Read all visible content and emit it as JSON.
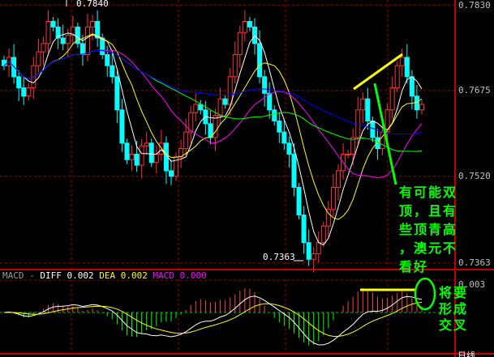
{
  "chart_data": {
    "type": "candlestick",
    "price_axis": {
      "ticks": [
        0.783,
        0.7675,
        0.752,
        0.7363
      ],
      "ylim": [
        0.7363,
        0.783
      ]
    },
    "max_label": "0.7840",
    "min_label": "0.7363",
    "closes": [
      0.772,
      0.7735,
      0.77,
      0.768,
      0.7665,
      0.768,
      0.772,
      0.7745,
      0.776,
      0.78,
      0.779,
      0.777,
      0.776,
      0.7775,
      0.779,
      0.776,
      0.774,
      0.779,
      0.78,
      0.777,
      0.774,
      0.772,
      0.77,
      0.764,
      0.758,
      0.755,
      0.756,
      0.754,
      0.7575,
      0.758,
      0.7545,
      0.756,
      0.758,
      0.753,
      0.752,
      0.7555,
      0.757,
      0.76,
      0.7635,
      0.765,
      0.764,
      0.7615,
      0.759,
      0.763,
      0.766,
      0.765,
      0.77,
      0.774,
      0.778,
      0.78,
      0.779,
      0.776,
      0.77,
      0.767,
      0.764,
      0.762,
      0.76,
      0.758,
      0.756,
      0.75,
      0.745,
      0.74,
      0.737,
      0.738,
      0.74,
      0.743,
      0.746,
      0.75,
      0.753,
      0.756,
      0.756,
      0.759,
      0.764,
      0.766,
      0.762,
      0.759,
      0.757,
      0.76,
      0.764,
      0.768,
      0.772,
      0.7735,
      0.77,
      0.7665,
      0.764,
      0.765
    ],
    "moving_averages": [
      {
        "period": 5,
        "color": "#ffffff"
      },
      {
        "period": 10,
        "color": "#ffff00"
      },
      {
        "period": 20,
        "color": "#ff00ff"
      },
      {
        "period": 30,
        "color": "#00ff00"
      },
      {
        "period": 60,
        "color": "#0000ff"
      }
    ],
    "macd": {
      "name": "MACD",
      "diff_label": "DIFF",
      "diff": "0.002",
      "dea_label": "DEA",
      "dea": "0.002",
      "macd_label": "MACD",
      "macd": "0.000",
      "tick": "0.003"
    },
    "period_label": "日线"
  },
  "annotations": {
    "note1": [
      "有可能双",
      "顶，且有",
      "些顶青高",
      "，澳元不",
      "看好"
    ],
    "note2": [
      "将要",
      "形成",
      "交叉"
    ]
  },
  "colors": {
    "up": "#ff3232",
    "down": "#00ffff",
    "grid": "#a00000",
    "note": "#00ff00",
    "trend": "#ffff00"
  }
}
